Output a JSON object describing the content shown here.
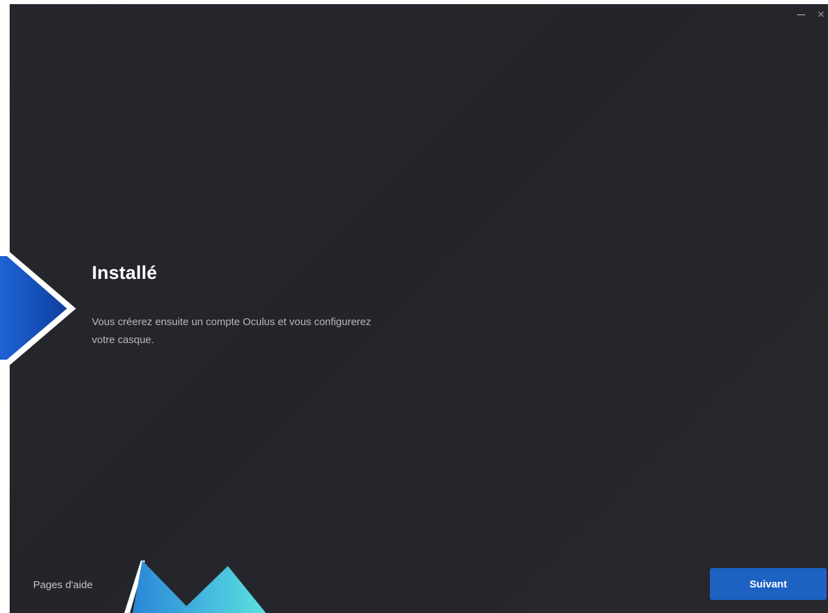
{
  "window": {
    "controls": {
      "minimize_icon": "minimize-icon",
      "close_glyph": "×"
    }
  },
  "main": {
    "title": "Installé",
    "description": "Vous créerez ensuite un compte Oculus et vous configurerez votre casque."
  },
  "footer": {
    "help_link": "Pages d'aide",
    "next_button": "Suivant"
  },
  "colors": {
    "background": "#24262b",
    "accent": "#1d62c2",
    "decoration_blue": "#1a56c4",
    "decoration_cyan": "#4fd6e0"
  }
}
